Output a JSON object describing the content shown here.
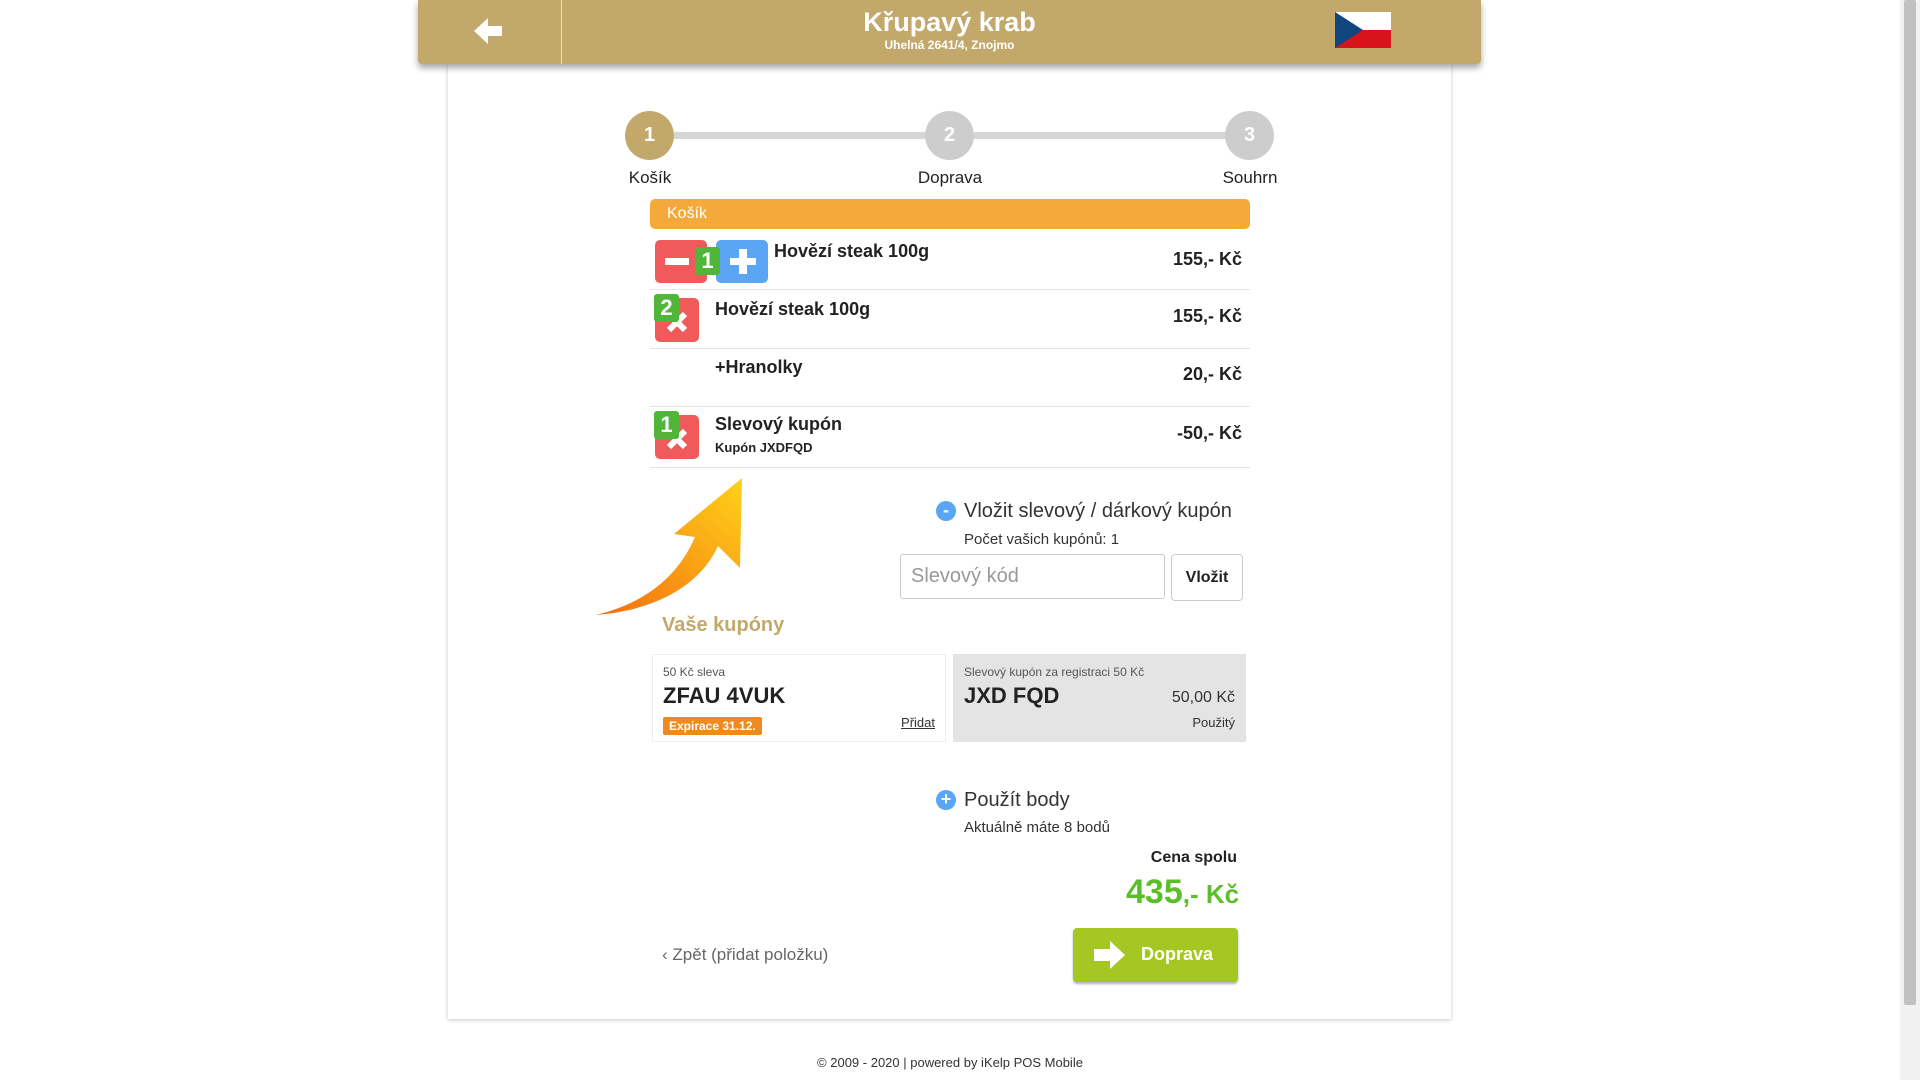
{
  "header": {
    "title": "Křupavý krab",
    "address": "Uhelná 2641/4, Znojmo",
    "back_icon": "arrow-left-icon",
    "flag_icon": "czech-flag-icon"
  },
  "steps": [
    {
      "number": "1",
      "label": "Košík",
      "active": true
    },
    {
      "number": "2",
      "label": "Doprava",
      "active": false
    },
    {
      "number": "3",
      "label": "Souhrn",
      "active": false
    }
  ],
  "cart": {
    "title": "Košík",
    "items": [
      {
        "qty": "1",
        "name": "Hovězí steak 100g",
        "price": "155,- Kč"
      },
      {
        "qty": "2",
        "name": "Hovězí steak 100g",
        "price": "155,- Kč"
      },
      {
        "name": "+Hranolky",
        "price": "20,- Kč"
      },
      {
        "qty": "1",
        "name": "Slevový kupón",
        "sub": "Kupón JXDFQD",
        "price": "-50,- Kč"
      }
    ]
  },
  "coupon_entry": {
    "toggle": "-",
    "title": "Vložit slevový / dárkový kupón",
    "count_text": "Počet vašich kupónů: 1",
    "placeholder": "Slevový kód",
    "insert_label": "Vložit"
  },
  "your_coupons": {
    "title": "Vaše kupóny",
    "list": [
      {
        "subtitle": "50 Kč sleva",
        "code": "ZFAU 4VUK",
        "expiry": "Expirace 31.12.",
        "action": "Přidat"
      },
      {
        "subtitle": "Slevový kupón za registraci 50 Kč",
        "code": "JXD FQD",
        "value": "50,00 Kč",
        "status": "Použitý"
      }
    ]
  },
  "points": {
    "toggle": "+",
    "title": "Použít body",
    "note": "Aktuálně máte 8 bodů"
  },
  "total": {
    "label": "Cena spolu",
    "amount": "435",
    "suffix": ",- Kč"
  },
  "nav": {
    "back_label": "Zpět (přidat položku)",
    "next_label": "Doprava"
  },
  "footer": {
    "text": "© 2009 - 2020 | powered by iKelp POS Mobile"
  },
  "colors": {
    "brand": "#c2a96b",
    "cart_bar": "#f4a93a",
    "accent_green": "#a4c721",
    "total_green": "#5bbf2a",
    "remove_red": "#f05a5a",
    "add_blue": "#5aa6f5"
  }
}
